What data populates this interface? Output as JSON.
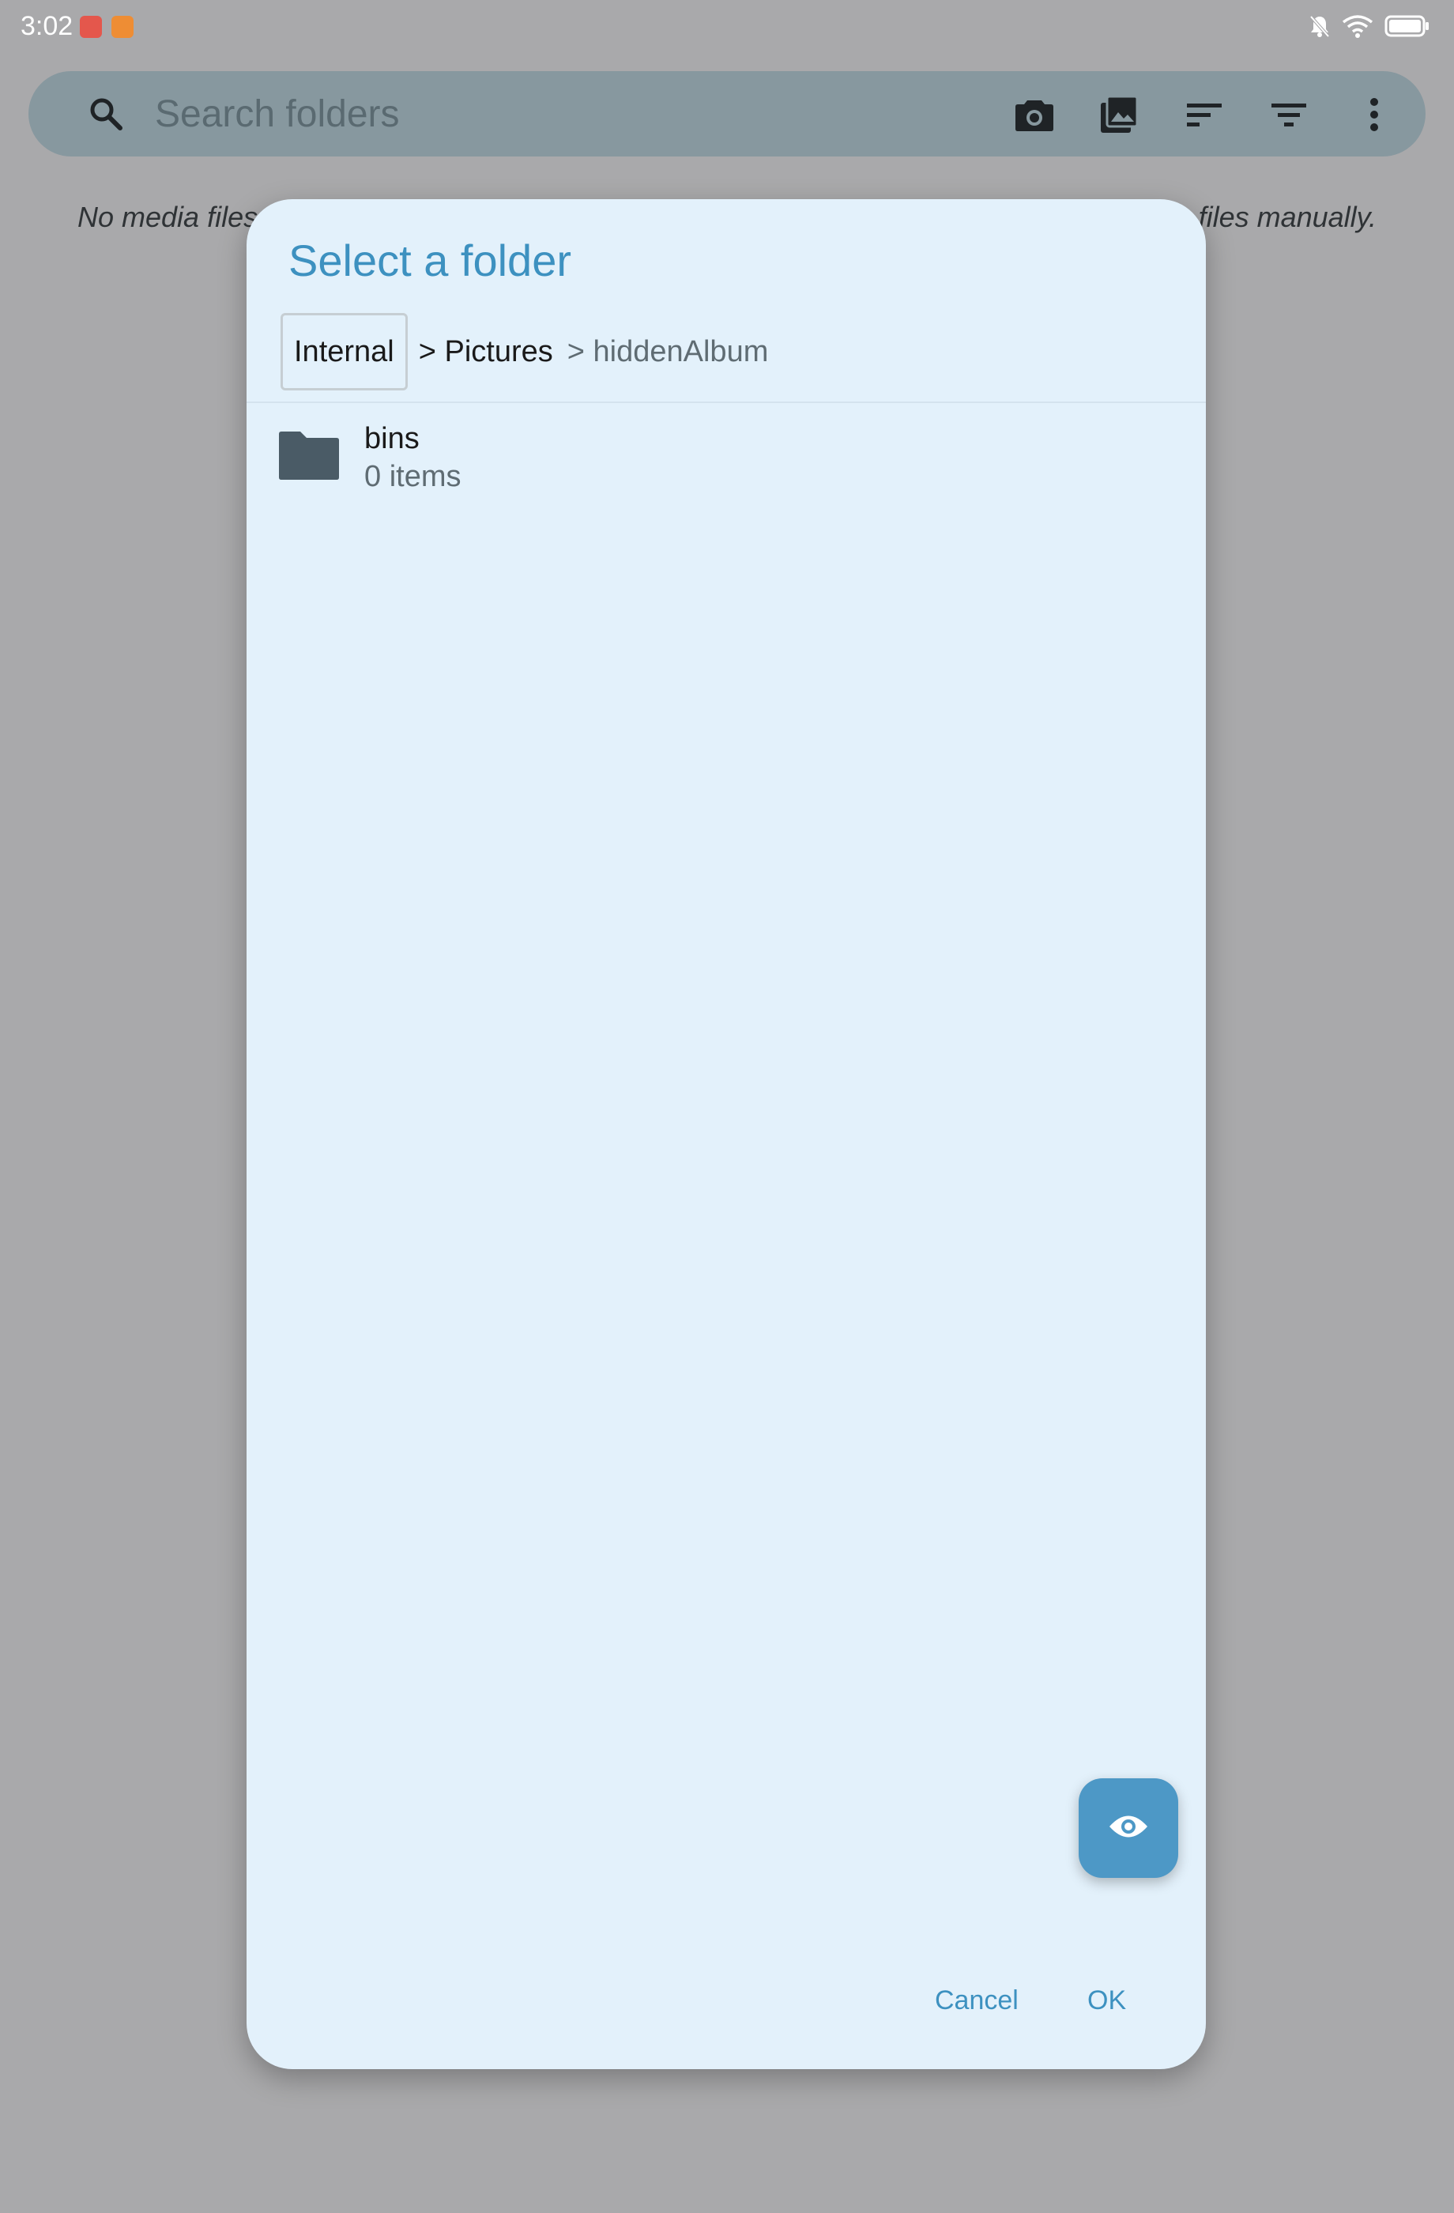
{
  "status_bar": {
    "time": "3:02",
    "notification_icons": [
      "app-notification-icon",
      "calendar-notification-icon"
    ],
    "system_icons": [
      "notifications-off-icon",
      "wifi-icon",
      "battery-icon"
    ]
  },
  "search": {
    "placeholder": "Search folders",
    "toolbar_icons": [
      "camera-icon",
      "gallery-icon",
      "sort-icon",
      "filter-icon",
      "more-options-icon"
    ]
  },
  "background": {
    "message_left": "No media files",
    "message_right": "files manually."
  },
  "dialog": {
    "title": "Select a folder",
    "breadcrumbs": [
      {
        "label": "Internal"
      },
      {
        "label": "> Pictures"
      },
      {
        "label": "> hiddenAlbum"
      }
    ],
    "folders": [
      {
        "name": "bins",
        "count": "0 items"
      }
    ],
    "fab_icon": "eye-icon",
    "buttons": {
      "cancel": "Cancel",
      "ok": "OK"
    }
  },
  "colors": {
    "accent": "#3d91c0",
    "fab": "#4d98c6",
    "dialog_bg": "#e3f1fb",
    "search_bar_bg": "#87989f",
    "scrim": "#a9a9ab",
    "folder_icon": "#4a5b66"
  }
}
